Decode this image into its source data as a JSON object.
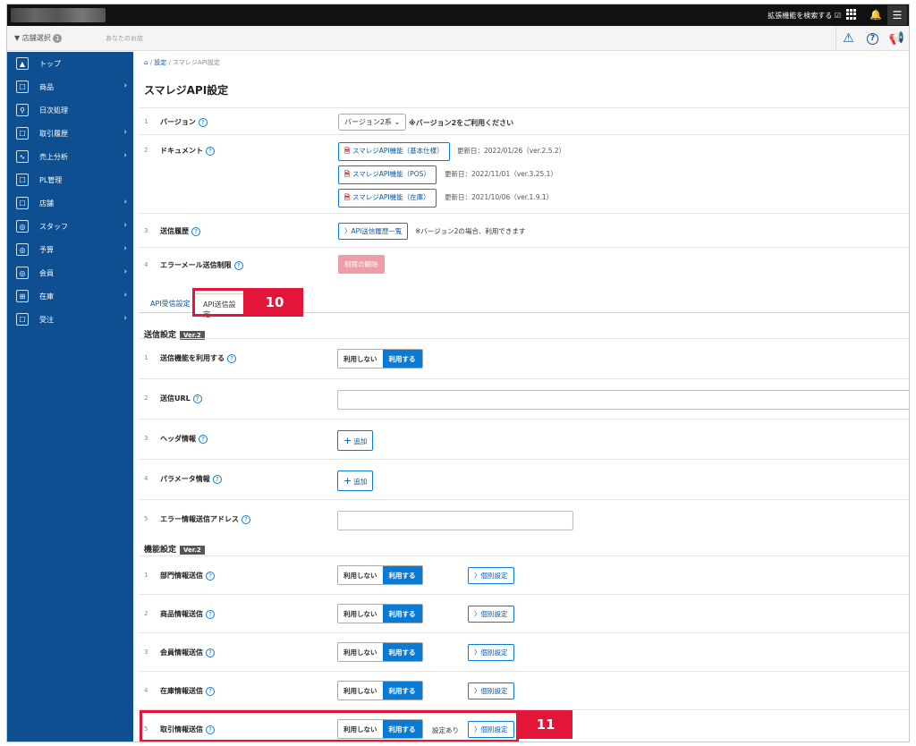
{
  "topbar": {
    "extension_search": "拡張機能を検索する ☑",
    "grid_icon": "apps-grid-icon",
    "bell_icon": "bell-icon",
    "menu_icon": "hamburger-menu-icon",
    "menu_glyph": "☰"
  },
  "subbar": {
    "store_select": "▼ 店舗選択",
    "store_count": "1",
    "user_label": "あなたのお店",
    "icons": [
      "warning-icon",
      "help-icon",
      "megaphone-icon"
    ],
    "icon_glyphs": [
      "⚠",
      "?",
      "📢"
    ]
  },
  "sidebar": {
    "items": [
      {
        "label": "トップ",
        "icon": "home-icon",
        "glyph": "▲",
        "chevron": false
      },
      {
        "label": "商品",
        "icon": "product-icon",
        "glyph": "☐",
        "chevron": true
      },
      {
        "label": "日次処理",
        "icon": "daily-icon",
        "glyph": "⚲",
        "chevron": false
      },
      {
        "label": "取引履歴",
        "icon": "history-icon",
        "glyph": "☐",
        "chevron": true
      },
      {
        "label": "売上分析",
        "icon": "chart-icon",
        "glyph": "∿",
        "chevron": true
      },
      {
        "label": "PL管理",
        "icon": "pl-icon",
        "glyph": "☐",
        "chevron": false
      },
      {
        "label": "店舗",
        "icon": "store-icon",
        "glyph": "☐",
        "chevron": true
      },
      {
        "label": "スタッフ",
        "icon": "staff-icon",
        "glyph": "◎",
        "chevron": true
      },
      {
        "label": "予算",
        "icon": "budget-icon",
        "glyph": "◎",
        "chevron": true
      },
      {
        "label": "会員",
        "icon": "member-icon",
        "glyph": "◎",
        "chevron": true
      },
      {
        "label": "在庫",
        "icon": "stock-icon",
        "glyph": "⊞",
        "chevron": true
      },
      {
        "label": "受注",
        "icon": "order-icon",
        "glyph": "☐",
        "chevron": true
      }
    ],
    "chevron_glyph": "›"
  },
  "breadcrumb": {
    "home_glyph": "⌂",
    "sep": "/",
    "item1": "設定",
    "item2": "スマレジAPI設定"
  },
  "page_title": "スマレジAPI設定",
  "settings": {
    "version": {
      "num": "1",
      "label": "バージョン",
      "value": "バージョン2系 ⌄",
      "note": "※バージョン2をご利用ください"
    },
    "document": {
      "num": "2",
      "label": "ドキュメント",
      "docs": [
        {
          "label": "スマレジAPI機能（基本仕様）",
          "updated": "更新日：2022/01/26（ver.2.5.2）"
        },
        {
          "label": "スマレジAPI機能（POS）",
          "updated": "更新日：2022/11/01（ver.3.25.1）"
        },
        {
          "label": "スマレジAPI機能（在庫）",
          "updated": "更新日：2021/10/06（ver.1.9.1）"
        }
      ],
      "pdf_glyph": "🗎"
    },
    "history": {
      "num": "3",
      "label": "送信履歴",
      "button": "〉API送信履歴一覧",
      "note": "※バージョン2の場合、利用できます"
    },
    "error_mail": {
      "num": "4",
      "label": "エラーメール送信制限",
      "button": "制限の解除"
    }
  },
  "help_glyph": "?",
  "tabs": {
    "receive": "API受信設定",
    "send": "API送信設定"
  },
  "send_section": {
    "title": "送信設定",
    "badge": "Ver.2",
    "rows": [
      {
        "num": "1",
        "label": "送信機能を利用する"
      },
      {
        "num": "2",
        "label": "送信URL"
      },
      {
        "num": "3",
        "label": "ヘッダ情報"
      },
      {
        "num": "4",
        "label": "パラメータ情報"
      },
      {
        "num": "5",
        "label": "エラー情報送信アドレス"
      }
    ],
    "add_label": "追加",
    "add_glyph": "+",
    "url_value": "",
    "email_value": ""
  },
  "func_section": {
    "title": "機能設定",
    "badge": "Ver.2",
    "rows": [
      {
        "num": "1",
        "label": "部門情報送信",
        "status": ""
      },
      {
        "num": "2",
        "label": "商品情報送信",
        "status": ""
      },
      {
        "num": "3",
        "label": "会員情報送信",
        "status": ""
      },
      {
        "num": "4",
        "label": "在庫情報送信",
        "status": ""
      },
      {
        "num": "5",
        "label": "取引情報送信",
        "status": "設定あり"
      }
    ],
    "detail_button": "〉個別設定"
  },
  "toggle": {
    "off": "利用しない",
    "on": "利用する"
  },
  "callouts": {
    "c10": "10",
    "c11": "11"
  },
  "colors": {
    "sidebar": "#0d4f91",
    "accent": "#0a7bd4",
    "callout": "#e3163a"
  }
}
